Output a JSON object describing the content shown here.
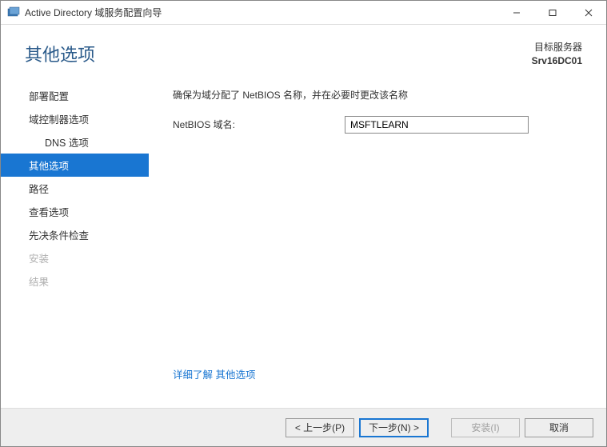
{
  "window": {
    "title": "Active Directory 域服务配置向导"
  },
  "header": {
    "page_title": "其他选项",
    "target_label": "目标服务器",
    "target_server": "Srv16DC01"
  },
  "sidebar": {
    "items": [
      {
        "label": "部署配置",
        "selected": false,
        "disabled": false,
        "indent": false
      },
      {
        "label": "域控制器选项",
        "selected": false,
        "disabled": false,
        "indent": false
      },
      {
        "label": "DNS 选项",
        "selected": false,
        "disabled": false,
        "indent": true
      },
      {
        "label": "其他选项",
        "selected": true,
        "disabled": false,
        "indent": false
      },
      {
        "label": "路径",
        "selected": false,
        "disabled": false,
        "indent": false
      },
      {
        "label": "查看选项",
        "selected": false,
        "disabled": false,
        "indent": false
      },
      {
        "label": "先决条件检查",
        "selected": false,
        "disabled": false,
        "indent": false
      },
      {
        "label": "安装",
        "selected": false,
        "disabled": true,
        "indent": false
      },
      {
        "label": "结果",
        "selected": false,
        "disabled": true,
        "indent": false
      }
    ]
  },
  "main": {
    "description": "确保为域分配了 NetBIOS 名称，并在必要时更改该名称",
    "netbios_label": "NetBIOS 域名:",
    "netbios_value": "MSFTLEARN",
    "more_prefix": "详细了解",
    "more_link": "其他选项"
  },
  "footer": {
    "prev": "< 上一步(P)",
    "next": "下一步(N) >",
    "install": "安装(I)",
    "cancel": "取消"
  }
}
